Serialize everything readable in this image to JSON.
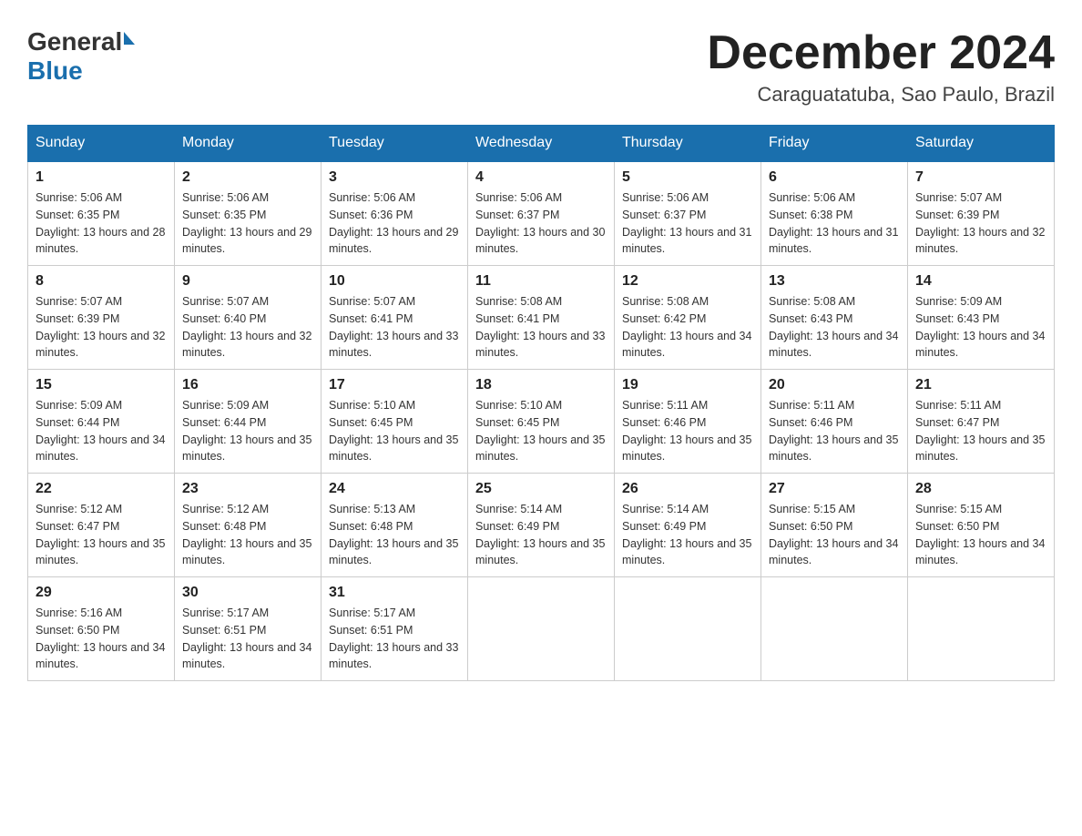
{
  "header": {
    "logo": {
      "general": "General",
      "blue": "Blue"
    },
    "title": "December 2024",
    "location": "Caraguatatuba, Sao Paulo, Brazil"
  },
  "columns": [
    "Sunday",
    "Monday",
    "Tuesday",
    "Wednesday",
    "Thursday",
    "Friday",
    "Saturday"
  ],
  "weeks": [
    [
      {
        "day": "1",
        "sunrise": "5:06 AM",
        "sunset": "6:35 PM",
        "daylight": "13 hours and 28 minutes."
      },
      {
        "day": "2",
        "sunrise": "5:06 AM",
        "sunset": "6:35 PM",
        "daylight": "13 hours and 29 minutes."
      },
      {
        "day": "3",
        "sunrise": "5:06 AM",
        "sunset": "6:36 PM",
        "daylight": "13 hours and 29 minutes."
      },
      {
        "day": "4",
        "sunrise": "5:06 AM",
        "sunset": "6:37 PM",
        "daylight": "13 hours and 30 minutes."
      },
      {
        "day": "5",
        "sunrise": "5:06 AM",
        "sunset": "6:37 PM",
        "daylight": "13 hours and 31 minutes."
      },
      {
        "day": "6",
        "sunrise": "5:06 AM",
        "sunset": "6:38 PM",
        "daylight": "13 hours and 31 minutes."
      },
      {
        "day": "7",
        "sunrise": "5:07 AM",
        "sunset": "6:39 PM",
        "daylight": "13 hours and 32 minutes."
      }
    ],
    [
      {
        "day": "8",
        "sunrise": "5:07 AM",
        "sunset": "6:39 PM",
        "daylight": "13 hours and 32 minutes."
      },
      {
        "day": "9",
        "sunrise": "5:07 AM",
        "sunset": "6:40 PM",
        "daylight": "13 hours and 32 minutes."
      },
      {
        "day": "10",
        "sunrise": "5:07 AM",
        "sunset": "6:41 PM",
        "daylight": "13 hours and 33 minutes."
      },
      {
        "day": "11",
        "sunrise": "5:08 AM",
        "sunset": "6:41 PM",
        "daylight": "13 hours and 33 minutes."
      },
      {
        "day": "12",
        "sunrise": "5:08 AM",
        "sunset": "6:42 PM",
        "daylight": "13 hours and 34 minutes."
      },
      {
        "day": "13",
        "sunrise": "5:08 AM",
        "sunset": "6:43 PM",
        "daylight": "13 hours and 34 minutes."
      },
      {
        "day": "14",
        "sunrise": "5:09 AM",
        "sunset": "6:43 PM",
        "daylight": "13 hours and 34 minutes."
      }
    ],
    [
      {
        "day": "15",
        "sunrise": "5:09 AM",
        "sunset": "6:44 PM",
        "daylight": "13 hours and 34 minutes."
      },
      {
        "day": "16",
        "sunrise": "5:09 AM",
        "sunset": "6:44 PM",
        "daylight": "13 hours and 35 minutes."
      },
      {
        "day": "17",
        "sunrise": "5:10 AM",
        "sunset": "6:45 PM",
        "daylight": "13 hours and 35 minutes."
      },
      {
        "day": "18",
        "sunrise": "5:10 AM",
        "sunset": "6:45 PM",
        "daylight": "13 hours and 35 minutes."
      },
      {
        "day": "19",
        "sunrise": "5:11 AM",
        "sunset": "6:46 PM",
        "daylight": "13 hours and 35 minutes."
      },
      {
        "day": "20",
        "sunrise": "5:11 AM",
        "sunset": "6:46 PM",
        "daylight": "13 hours and 35 minutes."
      },
      {
        "day": "21",
        "sunrise": "5:11 AM",
        "sunset": "6:47 PM",
        "daylight": "13 hours and 35 minutes."
      }
    ],
    [
      {
        "day": "22",
        "sunrise": "5:12 AM",
        "sunset": "6:47 PM",
        "daylight": "13 hours and 35 minutes."
      },
      {
        "day": "23",
        "sunrise": "5:12 AM",
        "sunset": "6:48 PM",
        "daylight": "13 hours and 35 minutes."
      },
      {
        "day": "24",
        "sunrise": "5:13 AM",
        "sunset": "6:48 PM",
        "daylight": "13 hours and 35 minutes."
      },
      {
        "day": "25",
        "sunrise": "5:14 AM",
        "sunset": "6:49 PM",
        "daylight": "13 hours and 35 minutes."
      },
      {
        "day": "26",
        "sunrise": "5:14 AM",
        "sunset": "6:49 PM",
        "daylight": "13 hours and 35 minutes."
      },
      {
        "day": "27",
        "sunrise": "5:15 AM",
        "sunset": "6:50 PM",
        "daylight": "13 hours and 34 minutes."
      },
      {
        "day": "28",
        "sunrise": "5:15 AM",
        "sunset": "6:50 PM",
        "daylight": "13 hours and 34 minutes."
      }
    ],
    [
      {
        "day": "29",
        "sunrise": "5:16 AM",
        "sunset": "6:50 PM",
        "daylight": "13 hours and 34 minutes."
      },
      {
        "day": "30",
        "sunrise": "5:17 AM",
        "sunset": "6:51 PM",
        "daylight": "13 hours and 34 minutes."
      },
      {
        "day": "31",
        "sunrise": "5:17 AM",
        "sunset": "6:51 PM",
        "daylight": "13 hours and 33 minutes."
      },
      null,
      null,
      null,
      null
    ]
  ]
}
